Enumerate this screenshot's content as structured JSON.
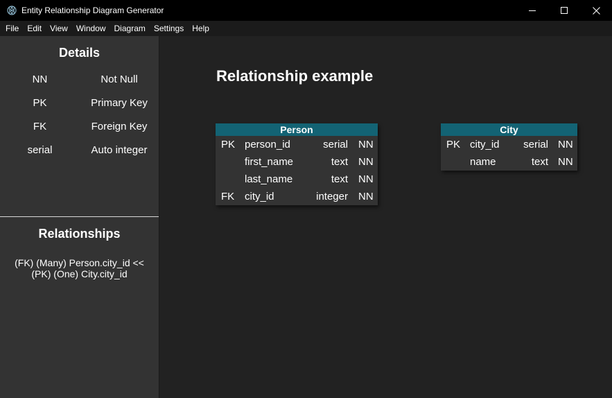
{
  "window": {
    "title": "Entity Relationship Diagram Generator"
  },
  "menu": [
    "File",
    "Edit",
    "View",
    "Window",
    "Diagram",
    "Settings",
    "Help"
  ],
  "sidebar": {
    "details_title": "Details",
    "details": [
      {
        "abbr": "NN",
        "desc": "Not Null"
      },
      {
        "abbr": "PK",
        "desc": "Primary Key"
      },
      {
        "abbr": "FK",
        "desc": "Foreign Key"
      },
      {
        "abbr": "serial",
        "desc": "Auto integer"
      }
    ],
    "relationships_title": "Relationships",
    "relationships": [
      "(FK) (Many) Person.city_id << (PK) (One) City.city_id"
    ]
  },
  "diagram": {
    "title": "Relationship example",
    "entities": [
      {
        "name": "Person",
        "columns": [
          {
            "key": "PK",
            "name": "person_id",
            "type": "serial",
            "null": "NN"
          },
          {
            "key": "",
            "name": "first_name",
            "type": "text",
            "null": "NN"
          },
          {
            "key": "",
            "name": "last_name",
            "type": "text",
            "null": "NN"
          },
          {
            "key": "FK",
            "name": "city_id",
            "type": "integer",
            "null": "NN"
          }
        ]
      },
      {
        "name": "City",
        "columns": [
          {
            "key": "PK",
            "name": "city_id",
            "type": "serial",
            "null": "NN"
          },
          {
            "key": "",
            "name": "name",
            "type": "text",
            "null": "NN"
          }
        ]
      }
    ]
  },
  "colors": {
    "entity_header": "#136374",
    "canvas": "#222222",
    "sidebar": "#333333",
    "titlebar": "#000000"
  }
}
